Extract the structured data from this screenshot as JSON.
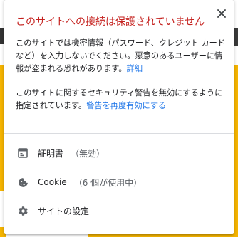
{
  "popup": {
    "title": "このサイトへの接続は保護されていません",
    "warning_text": "このサイトでは機密情報（パスワード、クレジット カードなど）を入力しないでください。悪意のあるユーザーに情報が盗まれる恐れがあります。",
    "details_link": "詳細",
    "disabled_text": "このサイトに関するセキュリティ警告を無効にするように指定されています。",
    "reenable_link": "警告を再度有効にする",
    "close_icon": "close-icon",
    "accent_color": "#c5221f",
    "link_color": "#1a73e8"
  },
  "rows": {
    "certificate": {
      "label": "証明書",
      "status": "（無効）",
      "icon": "certificate-icon"
    },
    "cookie": {
      "label": "Cookie",
      "status": "（6 個が使用中）",
      "icon": "cookie-icon"
    },
    "site_settings": {
      "label": "サイトの設定",
      "icon": "gear-icon"
    }
  }
}
